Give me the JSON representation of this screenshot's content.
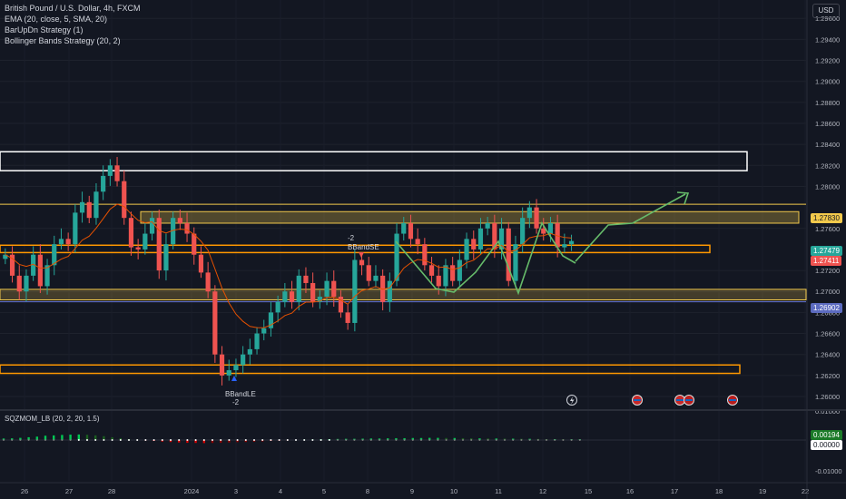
{
  "legend": {
    "title": "British Pound / U.S. Dollar, 4h, FXCM",
    "ema": "EMA (20, close, 5, SMA, 20)",
    "barupdn": "BarUpDn Strategy (1)",
    "bollinger": "Bollinger Bands Strategy (20, 2)"
  },
  "currency_button": "USD",
  "oscillator_label": "SQZMOM_LB (20, 2, 20, 1.5)",
  "price_badges": {
    "level_1": "1.27830",
    "level_2": "1.27479",
    "level_3": "1.27411",
    "level_4": "1.26902",
    "osc_1": "0.00194",
    "osc_2": "0.00000"
  },
  "signals": {
    "short": {
      "name": "BBandSE",
      "qty": "-2"
    },
    "long": {
      "name": "BBandLE",
      "qty": "-2"
    }
  },
  "colors": {
    "background": "#131722",
    "up": "#26a69a",
    "down": "#ef5350",
    "zone": "#f2c94c",
    "box": "#ff9800",
    "arrow": "#66bb6a",
    "ema": "#e65100",
    "support": "#5c6bc0"
  },
  "chart_data": {
    "type": "candlestick",
    "timeframe": "4h",
    "y_axis": {
      "range": [
        1.259,
        1.299
      ],
      "ticks": [
        "1.29800",
        "1.29600",
        "1.29400",
        "1.29200",
        "1.29000",
        "1.28800",
        "1.28600",
        "1.28400",
        "1.28200",
        "1.28000",
        "1.27600",
        "1.27200",
        "1.27000",
        "1.26800",
        "1.26600",
        "1.26400",
        "1.26200",
        "1.26000"
      ]
    },
    "x_axis": {
      "tick_labels": [
        "26",
        "27",
        "28",
        "2024",
        "3",
        "4",
        "5",
        "8",
        "9",
        "10",
        "11",
        "12",
        "15",
        "16",
        "17",
        "18",
        "19",
        "22"
      ]
    },
    "levels": {
      "upper_box": [
        1.2815,
        1.2833
      ],
      "resistance_zone": [
        1.2765,
        1.2776
      ],
      "mid_box": [
        1.2737,
        1.2744
      ],
      "support_zone": [
        1.2692,
        1.2702
      ],
      "support_line": 1.26902,
      "lower_box": [
        1.2622,
        1.263
      ],
      "price_line": 1.2783
    },
    "closes": [
      1.2735,
      1.2715,
      1.27,
      1.2715,
      1.2735,
      1.2705,
      1.2725,
      1.2745,
      1.275,
      1.2745,
      1.2775,
      1.2785,
      1.277,
      1.2795,
      1.281,
      1.282,
      1.2805,
      1.277,
      1.2742,
      1.274,
      1.2755,
      1.277,
      1.272,
      1.2745,
      1.277,
      1.2765,
      1.2755,
      1.2735,
      1.2718,
      1.27,
      1.264,
      1.262,
      1.2625,
      1.263,
      1.264,
      1.2645,
      1.266,
      1.2665,
      1.268,
      1.269,
      1.27,
      1.269,
      1.2715,
      1.2708,
      1.269,
      1.2695,
      1.271,
      1.2695,
      1.268,
      1.267,
      1.273,
      1.2725,
      1.271,
      1.2715,
      1.269,
      1.271,
      1.2755,
      1.2765,
      1.275,
      1.2745,
      1.2725,
      1.2715,
      1.2705,
      1.2725,
      1.271,
      1.273,
      1.275,
      1.274,
      1.276,
      1.2765,
      1.274,
      1.276,
      1.271,
      1.2745,
      1.277,
      1.278,
      1.276,
      1.2755,
      1.2765,
      1.2742,
      1.2745,
      1.2748
    ],
    "squeeze_momentum": [
      0.001,
      0.0011,
      0.0014,
      0.0018,
      0.0022,
      0.0028,
      0.003,
      0.0033,
      0.0035,
      0.0036,
      0.0034,
      0.003,
      0.0025,
      0.0018,
      0.0012,
      0.0006,
      0.0002,
      -0.0002,
      -0.0006,
      -0.001,
      -0.0013,
      -0.0016,
      -0.0018,
      -0.0019,
      -0.002,
      -0.0019,
      -0.0018,
      -0.0016,
      -0.0014,
      -0.0013,
      -0.0011,
      -0.0009,
      -0.0006,
      -0.0004,
      -0.0002,
      0.0,
      0.0002,
      0.0003,
      0.0004,
      0.0006,
      0.0007,
      0.0008,
      0.0008,
      0.0009,
      0.001,
      0.001,
      0.0011,
      0.0012,
      0.0012,
      0.0013,
      0.0013,
      0.0014,
      0.0014,
      0.0013,
      0.0013,
      0.0012,
      0.0011,
      0.0011,
      0.001,
      0.001,
      0.0009,
      0.0009,
      0.0008,
      0.0008,
      0.0007,
      0.0006,
      0.0006,
      0.0005,
      0.0005,
      0.0005
    ],
    "oscillator_ticks": [
      "0.01000",
      "-0.01000"
    ],
    "event_markers": [
      "lightning",
      "uk-flag",
      "uk-flag",
      "us-flag",
      "us-flag"
    ]
  }
}
